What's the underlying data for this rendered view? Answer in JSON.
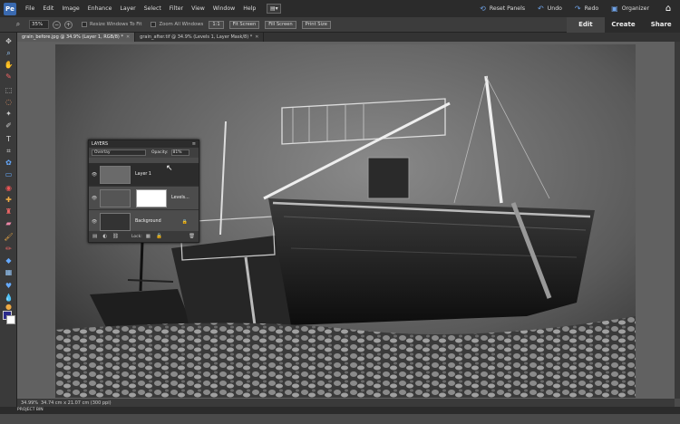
{
  "menu": {
    "items": [
      "File",
      "Edit",
      "Image",
      "Enhance",
      "Layer",
      "Select",
      "Filter",
      "View",
      "Window",
      "Help"
    ],
    "dropdown_icon": "screen-mode-icon"
  },
  "header_actions": {
    "reset_panels": "Reset Panels",
    "undo": "Undo",
    "redo": "Redo",
    "organizer": "Organizer"
  },
  "modes": [
    "Edit",
    "Create",
    "Share"
  ],
  "options": {
    "zoom_value": "35%",
    "resize_windows": "Resize Windows To Fit",
    "zoom_all_windows": "Zoom All Windows",
    "btn_1to1": "1:1",
    "fit_screen": "Fit Screen",
    "fill_screen": "Fill Screen",
    "print_size": "Print Size"
  },
  "document_tabs": [
    {
      "label": "grain_before.jpg @ 34.9% (Layer 1, RGB/8) *",
      "active": true
    },
    {
      "label": "grain_after.tif @ 34.9% (Levels 1, Layer Mask/8) *",
      "active": false
    }
  ],
  "layers_panel": {
    "title": "LAYERS",
    "blend_mode": "Overlay",
    "opacity_label": "Opacity:",
    "opacity_value": "81%",
    "layers": [
      {
        "name": "Layer 1",
        "selected": true
      },
      {
        "name": "Levels...",
        "selected": false
      },
      {
        "name": "Background",
        "selected": false
      }
    ],
    "lock_label": "Lock:"
  },
  "status": {
    "zoom": "34.99%",
    "doc_info": "34.74 cm x 21.07 cm (300 ppi)"
  },
  "project_bin": "PROJECT BIN",
  "colors": {
    "foreground": "#2a2a8a",
    "background": "#ffffff",
    "accent": "#6fa3e8"
  }
}
